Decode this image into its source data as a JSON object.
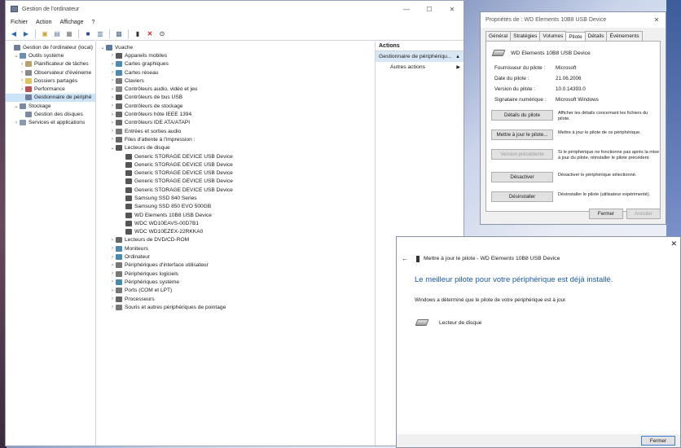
{
  "colors": {
    "accent": "#1e5aa8",
    "selection": "#cde3f7"
  },
  "cm": {
    "title": "Gestion de l'ordinateur",
    "menu": [
      "Fichier",
      "Action",
      "Affichage",
      "?"
    ],
    "left_tree": [
      {
        "label": "Gestion de l'ordinateur (local)",
        "icon": "computer-mgmt-icon",
        "level": 0,
        "toggle": "",
        "color": "#6f7f99"
      },
      {
        "label": "Outils système",
        "icon": "tools-icon",
        "level": 1,
        "toggle": "v",
        "color": "#6a8fb0"
      },
      {
        "label": "Planificateur de tâches",
        "icon": "clock-icon",
        "level": 2,
        "toggle": ">",
        "color": "#b9a36a"
      },
      {
        "label": "Observateur d'événeme",
        "icon": "event-viewer-icon",
        "level": 2,
        "toggle": ">",
        "color": "#8a8a8a"
      },
      {
        "label": "Dossiers partagés",
        "icon": "shared-folder-icon",
        "level": 2,
        "toggle": ">",
        "color": "#e2c25a"
      },
      {
        "label": "Performance",
        "icon": "performance-icon",
        "level": 2,
        "toggle": ">",
        "color": "#c05050"
      },
      {
        "label": "Gestionnaire de périphé",
        "icon": "device-manager-icon",
        "level": 2,
        "toggle": "",
        "color": "#6f7f99",
        "selected": true
      },
      {
        "label": "Stockage",
        "icon": "storage-icon",
        "level": 1,
        "toggle": "v",
        "color": "#7a8aa0"
      },
      {
        "label": "Gestion des disques",
        "icon": "disk-icon",
        "level": 2,
        "toggle": "",
        "color": "#7a8aa0"
      },
      {
        "label": "Services et applications",
        "icon": "services-icon",
        "level": 1,
        "toggle": ">",
        "color": "#8a9ab0"
      }
    ],
    "center_tree": [
      {
        "label": "Vuache",
        "icon": "computer-icon",
        "level": 0,
        "toggle": "v",
        "color": "#5a7aa0"
      },
      {
        "label": "Appareils mobiles",
        "icon": "mobile-icon",
        "level": 1,
        "toggle": ">",
        "color": "#5a5a5a"
      },
      {
        "label": "Cartes graphiques",
        "icon": "display-adapter-icon",
        "level": 1,
        "toggle": ">",
        "color": "#4a8ab0"
      },
      {
        "label": "Cartes réseau",
        "icon": "network-adapter-icon",
        "level": 1,
        "toggle": ">",
        "color": "#4a8ab0"
      },
      {
        "label": "Claviers",
        "icon": "keyboard-icon",
        "level": 1,
        "toggle": ">",
        "color": "#777"
      },
      {
        "label": "Contrôleurs audio, vidéo et jeu",
        "icon": "audio-icon",
        "level": 1,
        "toggle": ">",
        "color": "#888"
      },
      {
        "label": "Contrôleurs de bus USB",
        "icon": "usb-icon",
        "level": 1,
        "toggle": ">",
        "color": "#555"
      },
      {
        "label": "Contrôleurs de stockage",
        "icon": "storage-controller-icon",
        "level": 1,
        "toggle": ">",
        "color": "#666"
      },
      {
        "label": "Contrôleurs hôte IEEE 1394",
        "icon": "ieee1394-icon",
        "level": 1,
        "toggle": ">",
        "color": "#666"
      },
      {
        "label": "Contrôleurs IDE ATA/ATAPI",
        "icon": "ide-icon",
        "level": 1,
        "toggle": ">",
        "color": "#666"
      },
      {
        "label": "Entrées et sorties audio",
        "icon": "speaker-icon",
        "level": 1,
        "toggle": ">",
        "color": "#777"
      },
      {
        "label": "Files d'attente à l'impression :",
        "icon": "printer-icon",
        "level": 1,
        "toggle": ">",
        "color": "#666"
      },
      {
        "label": "Lecteurs de disque",
        "icon": "disk-drive-icon",
        "level": 1,
        "toggle": "v",
        "color": "#555"
      },
      {
        "label": "Generic STORAGE DEVICE USB Device",
        "icon": "disk-drive-icon",
        "level": 2,
        "toggle": "",
        "color": "#555"
      },
      {
        "label": "Generic STORAGE DEVICE USB Device",
        "icon": "disk-drive-icon",
        "level": 2,
        "toggle": "",
        "color": "#555"
      },
      {
        "label": "Generic STORAGE DEVICE USB Device",
        "icon": "disk-drive-icon",
        "level": 2,
        "toggle": "",
        "color": "#555"
      },
      {
        "label": "Generic STORAGE DEVICE USB Device",
        "icon": "disk-drive-icon",
        "level": 2,
        "toggle": "",
        "color": "#555"
      },
      {
        "label": "Generic STORAGE DEVICE USB Device",
        "icon": "disk-drive-icon",
        "level": 2,
        "toggle": "",
        "color": "#555"
      },
      {
        "label": "Samsung SSD 840 Series",
        "icon": "disk-drive-icon",
        "level": 2,
        "toggle": "",
        "color": "#555"
      },
      {
        "label": "Samsung SSD 850 EVO 500GB",
        "icon": "disk-drive-icon",
        "level": 2,
        "toggle": "",
        "color": "#555"
      },
      {
        "label": "WD Elements 10B8 USB Device",
        "icon": "disk-drive-icon",
        "level": 2,
        "toggle": "",
        "color": "#555"
      },
      {
        "label": "WDC WD10EAVS-00D7B1",
        "icon": "disk-drive-icon",
        "level": 2,
        "toggle": "",
        "color": "#555"
      },
      {
        "label": "WDC WD10EZEX-22RKKA0",
        "icon": "disk-drive-icon",
        "level": 2,
        "toggle": "",
        "color": "#555"
      },
      {
        "label": "Lecteurs de DVD/CD-ROM",
        "icon": "dvd-icon",
        "level": 1,
        "toggle": ">",
        "color": "#666"
      },
      {
        "label": "Moniteurs",
        "icon": "monitor-icon",
        "level": 1,
        "toggle": ">",
        "color": "#4a8ab0"
      },
      {
        "label": "Ordinateur",
        "icon": "computer-icon",
        "level": 1,
        "toggle": ">",
        "color": "#4a8ab0"
      },
      {
        "label": "Périphériques d'interface utilisateur",
        "icon": "hid-icon",
        "level": 1,
        "toggle": ">",
        "color": "#777"
      },
      {
        "label": "Périphériques logiciels",
        "icon": "software-device-icon",
        "level": 1,
        "toggle": ">",
        "color": "#777"
      },
      {
        "label": "Périphériques système",
        "icon": "system-device-icon",
        "level": 1,
        "toggle": ">",
        "color": "#4a8ab0"
      },
      {
        "label": "Ports (COM et LPT)",
        "icon": "port-icon",
        "level": 1,
        "toggle": ">",
        "color": "#777"
      },
      {
        "label": "Processeurs",
        "icon": "processor-icon",
        "level": 1,
        "toggle": ">",
        "color": "#666"
      },
      {
        "label": "Souris et autres périphériques de pointage",
        "icon": "mouse-icon",
        "level": 1,
        "toggle": ">",
        "color": "#777"
      }
    ],
    "actions": {
      "header": "Actions",
      "section": "Gestionnaire de périphériqu...",
      "items": [
        "Autres actions"
      ]
    }
  },
  "props": {
    "title": "Propriétés de : WD Elements 10B8 USB Device",
    "tabs": [
      "Général",
      "Stratégies",
      "Volumes",
      "Pilote",
      "Détails",
      "Événements"
    ],
    "active_tab": "Pilote",
    "device_name": "WD Elements 10B8 USB Device",
    "info": [
      {
        "k": "Fournisseur du pilote :",
        "v": "Microsoft"
      },
      {
        "k": "Date du pilote :",
        "v": "21.06.2006"
      },
      {
        "k": "Version du pilote :",
        "v": "10.0.14393.0"
      },
      {
        "k": "Signataire numérique :",
        "v": "Microsoft Windows"
      }
    ],
    "buttons": [
      {
        "label": "Détails du pilote",
        "desc": "Afficher les détails concernant les fichiers du pilote.",
        "disabled": false,
        "name": "driver-details-button"
      },
      {
        "label": "Mettre à jour le pilote...",
        "desc": "Mettre à jour le pilote de ce périphérique.",
        "disabled": false,
        "name": "update-driver-button"
      },
      {
        "label": "Version précédente",
        "desc": "Si le périphérique ne fonctionne pas après la mise à jour du pilote, réinstaller le pilote précédent.",
        "disabled": true,
        "name": "rollback-driver-button"
      },
      {
        "label": "Désactiver",
        "desc": "Désactiver le périphérique sélectionné.",
        "disabled": false,
        "name": "disable-device-button"
      },
      {
        "label": "Désinstaller",
        "desc": "Désinstaller le pilote (utilisateur expérimenté).",
        "disabled": false,
        "name": "uninstall-device-button"
      }
    ],
    "close_label": "Fermer",
    "cancel_label": "Annuler"
  },
  "update": {
    "header": "Mettre à jour le pilote - WD Elements 10B8 USB Device",
    "heading": "Le meilleur pilote pour votre périphérique est déjà installé.",
    "message": "Windows a déterminé que le pilote de votre périphérique est à jour.",
    "device_label": "Lecteur de disque",
    "close_label": "Fermer"
  }
}
